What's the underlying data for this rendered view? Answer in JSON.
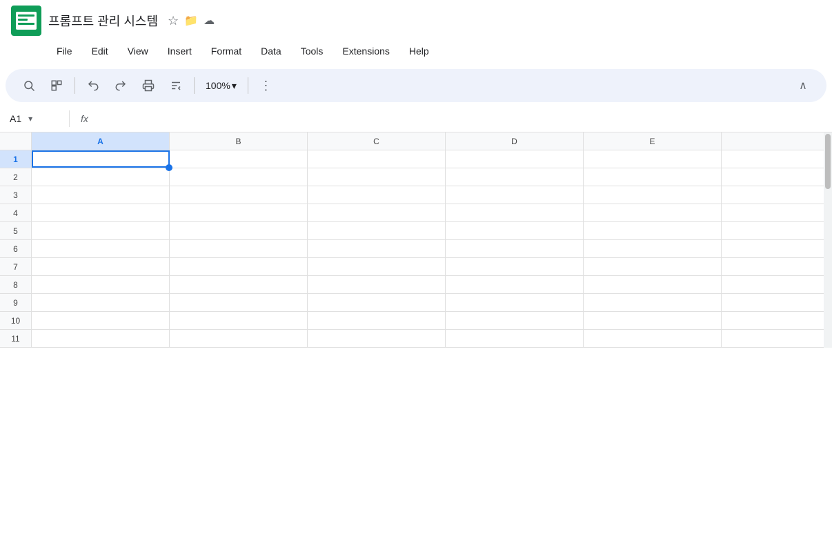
{
  "titleBar": {
    "title": "프롬프트 관리 시스템",
    "starIcon": "★",
    "folderIcon": "📁",
    "cloudIcon": "☁"
  },
  "menuBar": {
    "items": [
      "File",
      "Edit",
      "View",
      "Insert",
      "Format",
      "Data",
      "Tools",
      "Extensions",
      "Help"
    ]
  },
  "toolbar": {
    "searchIcon": "🔍",
    "formatPainterIcon": "⬜",
    "undoIcon": "↩",
    "redoIcon": "↪",
    "printIcon": "🖨",
    "formatIcon": "⬛",
    "zoom": "100%",
    "zoomDropIcon": "▾",
    "moreIcon": "⋮",
    "collapseIcon": "∧"
  },
  "cellBar": {
    "cellName": "A1",
    "dropIcon": "▾",
    "fxLabel": "fx"
  },
  "columns": [
    "A",
    "B",
    "C",
    "D",
    "E"
  ],
  "rows": [
    1,
    2,
    3,
    4,
    5,
    6,
    7,
    8,
    9,
    10,
    11
  ],
  "activeCell": {
    "row": 1,
    "col": "A"
  },
  "colors": {
    "accent": "#1a73e8",
    "activeCellBorder": "#1a73e8",
    "activeDot": "#1a73e8",
    "headerBg": "#f8f9fa",
    "toolbarBg": "#eef2fb",
    "logoGreen": "#0f9d58"
  }
}
